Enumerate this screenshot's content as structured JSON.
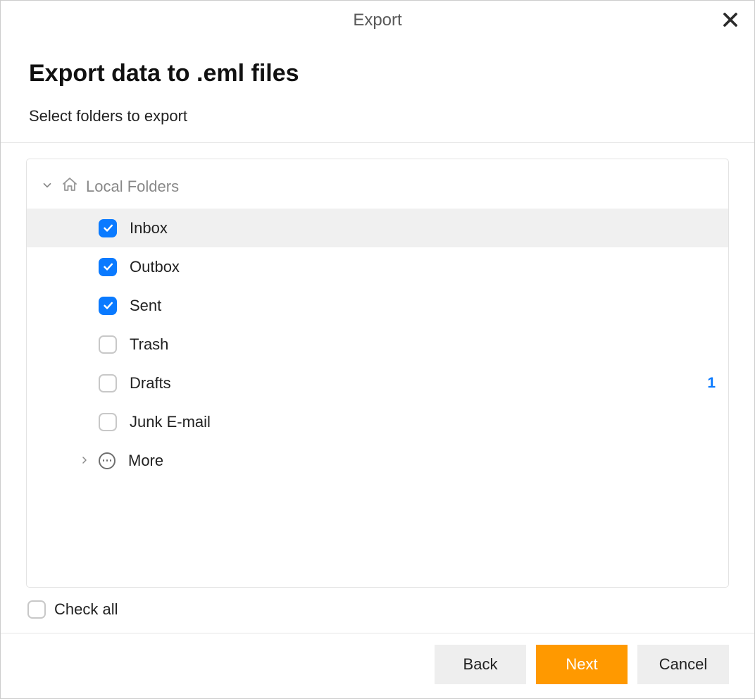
{
  "window": {
    "title": "Export"
  },
  "header": {
    "title": "Export data to .eml files",
    "subtitle": "Select folders to export"
  },
  "tree": {
    "root_label": "Local Folders",
    "folders": [
      {
        "label": "Inbox",
        "checked": true,
        "selected": true,
        "count": null
      },
      {
        "label": "Outbox",
        "checked": true,
        "selected": false,
        "count": null
      },
      {
        "label": "Sent",
        "checked": true,
        "selected": false,
        "count": null
      },
      {
        "label": "Trash",
        "checked": false,
        "selected": false,
        "count": null
      },
      {
        "label": "Drafts",
        "checked": false,
        "selected": false,
        "count": "1"
      },
      {
        "label": "Junk E-mail",
        "checked": false,
        "selected": false,
        "count": null
      }
    ],
    "more_label": "More"
  },
  "check_all": {
    "label": "Check all",
    "checked": false
  },
  "footer": {
    "back": "Back",
    "next": "Next",
    "cancel": "Cancel"
  }
}
